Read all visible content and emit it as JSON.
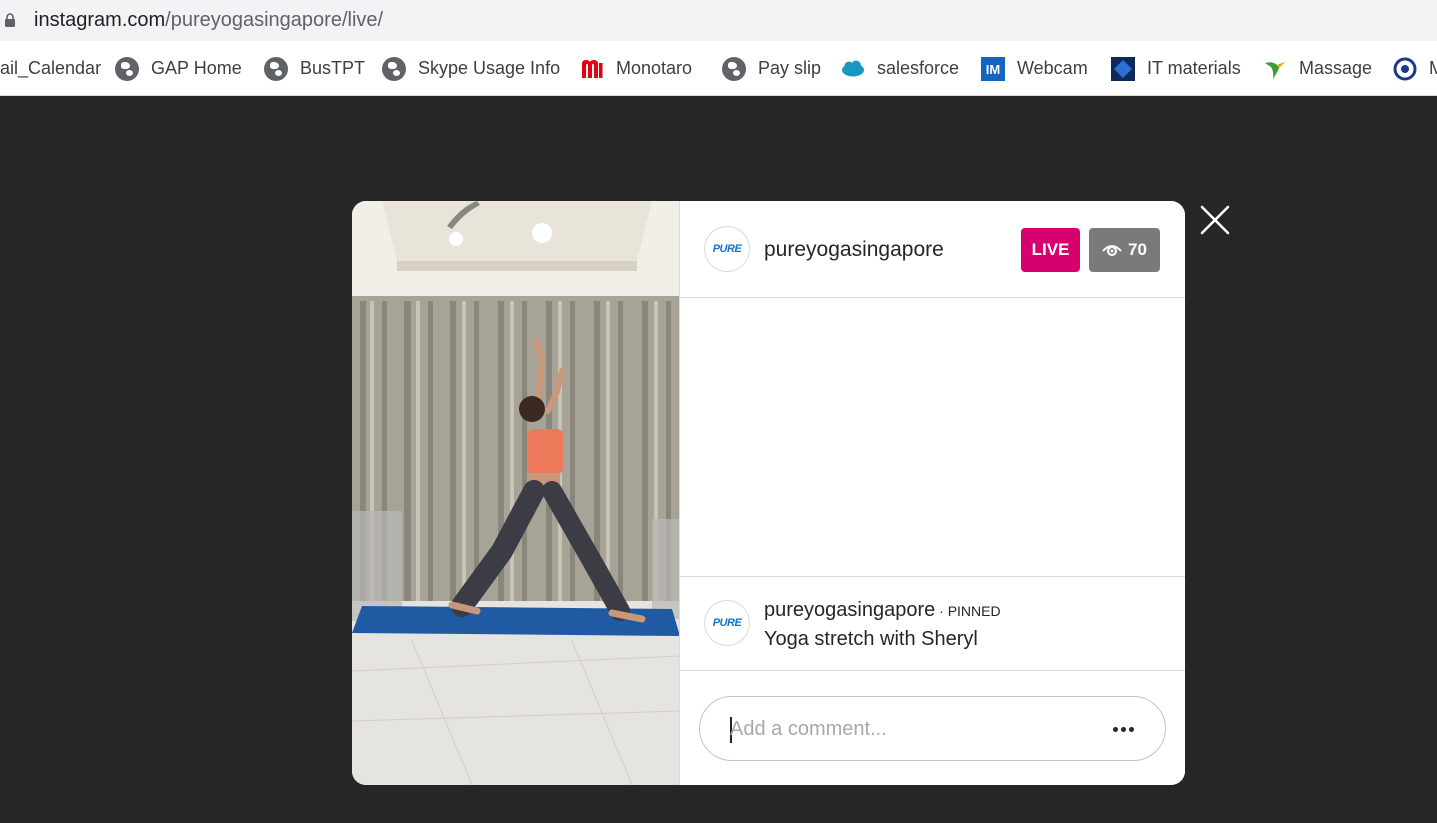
{
  "browser": {
    "url_domain": "instagram.com",
    "url_path": "/pureyogasingapore/live/"
  },
  "bookmarks": [
    {
      "label": "ail_Calendar",
      "icon": "none"
    },
    {
      "label": "GAP Home",
      "icon": "globe-icon"
    },
    {
      "label": "BusTPT",
      "icon": "globe-icon"
    },
    {
      "label": "Skype Usage Info",
      "icon": "globe-icon"
    },
    {
      "label": "Monotaro",
      "icon": "monotaro-icon"
    },
    {
      "label": "Pay slip",
      "icon": "globe-icon"
    },
    {
      "label": "salesforce",
      "icon": "salesforce-cloud-icon"
    },
    {
      "label": "Webcam",
      "icon": "im-icon"
    },
    {
      "label": "IT materials",
      "icon": "diamond-icon"
    },
    {
      "label": "Massage",
      "icon": "bird-icon"
    },
    {
      "label": "M",
      "icon": "circle-logo-icon"
    }
  ],
  "live": {
    "account": "pureyogasingapore",
    "avatar_text": "PURE",
    "live_label": "LIVE",
    "viewer_count": "70",
    "pinned_user": "pureyogasingapore",
    "pinned_tag": " · PINNED",
    "pinned_comment": "Yoga stretch with Sheryl",
    "comment_placeholder": "Add a comment..."
  },
  "colors": {
    "live": "#d6006f",
    "viewer_badge": "#7a7a7a",
    "backdrop": "#262626"
  }
}
